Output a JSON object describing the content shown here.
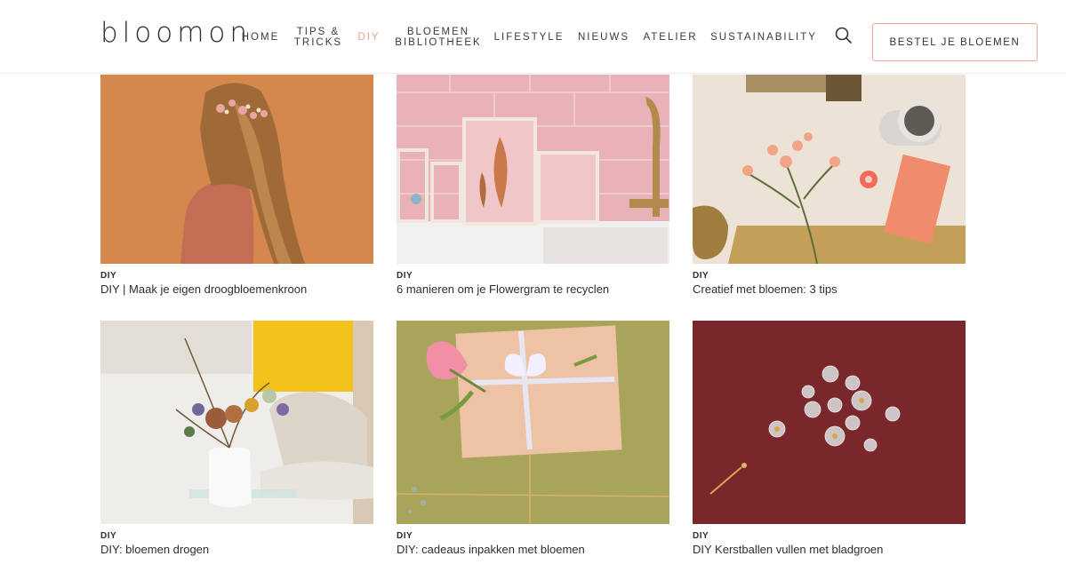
{
  "brand": {
    "logo_text": "bloomon"
  },
  "nav": {
    "items": [
      {
        "label": "HOME",
        "active": false
      },
      {
        "label": "TIPS &\nTRICKS",
        "active": false
      },
      {
        "label": "DIY",
        "active": true
      },
      {
        "label": "BLOEMEN\nBIBLIOTHEEK",
        "active": false
      },
      {
        "label": "LIFESTYLE",
        "active": false
      },
      {
        "label": "NIEUWS",
        "active": false
      },
      {
        "label": "ATELIER",
        "active": false
      },
      {
        "label": "SUSTAINABILITY",
        "active": false
      }
    ],
    "search_icon": "search-icon",
    "cta_label": "BESTEL JE BLOEMEN"
  },
  "colors": {
    "accent": "#e8a696",
    "text": "#2e2e2e"
  },
  "articles": [
    {
      "category": "DIY",
      "title": "DIY | Maak je eigen droogbloemenkroon",
      "image": "woman-with-flower-crown"
    },
    {
      "category": "DIY",
      "title": "6 manieren om je Flowergram te recyclen",
      "image": "framed-pressed-leaves"
    },
    {
      "category": "DIY",
      "title": "Creatief met bloemen: 3 tips",
      "image": "flowers-on-desk"
    },
    {
      "category": "DIY",
      "title": "DIY: bloemen drogen",
      "image": "dried-flowers-vase"
    },
    {
      "category": "DIY",
      "title": "DIY: cadeaus inpakken met bloemen",
      "image": "wrapped-gift-with-flower"
    },
    {
      "category": "DIY",
      "title": "DIY Kerstballen vullen met bladgroen",
      "image": "glass-baubles-on-red"
    }
  ]
}
